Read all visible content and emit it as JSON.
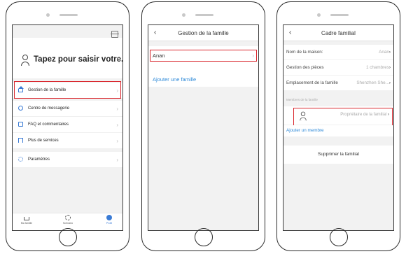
{
  "phone1": {
    "profile_prompt": "Tapez pour saisir votre...",
    "menu_group_1": [
      {
        "label": "Gestion de la famille",
        "icon": "home-icon"
      }
    ],
    "menu_group_2": [
      {
        "label": "Centre de messagerie",
        "icon": "message-icon"
      },
      {
        "label": "FAQ et commentaires",
        "icon": "faq-icon"
      },
      {
        "label": "Plus de services",
        "icon": "flag-icon"
      }
    ],
    "menu_group_3": [
      {
        "label": "Paramètres",
        "icon": "settings-icon"
      }
    ],
    "tabs": [
      {
        "label": "Ma famille",
        "icon": "home-icon"
      },
      {
        "label": "Scénario",
        "icon": "sun-icon"
      },
      {
        "label": "Profil",
        "icon": "user-icon",
        "active": true
      }
    ]
  },
  "phone2": {
    "title": "Gestion de la famille",
    "family_item": "Anan",
    "add_family": "Ajouter une famille"
  },
  "phone3": {
    "title": "Cadre familial",
    "rows": [
      {
        "key": "Nom de la maison:",
        "value": "Anan"
      },
      {
        "key": "Gestion des pièces",
        "value": "1 chambres"
      },
      {
        "key": "Emplacement de la famille",
        "value": "Shenzhen She..."
      }
    ],
    "members_label": "Membres de la famille",
    "member_role": "Propriétaire de la familial",
    "add_member": "Ajouter un membre",
    "delete_family": "Supprimer la familial"
  },
  "colors": {
    "accent": "#3a7bd5",
    "highlight": "#d9262d",
    "link": "#2f8ad8"
  }
}
